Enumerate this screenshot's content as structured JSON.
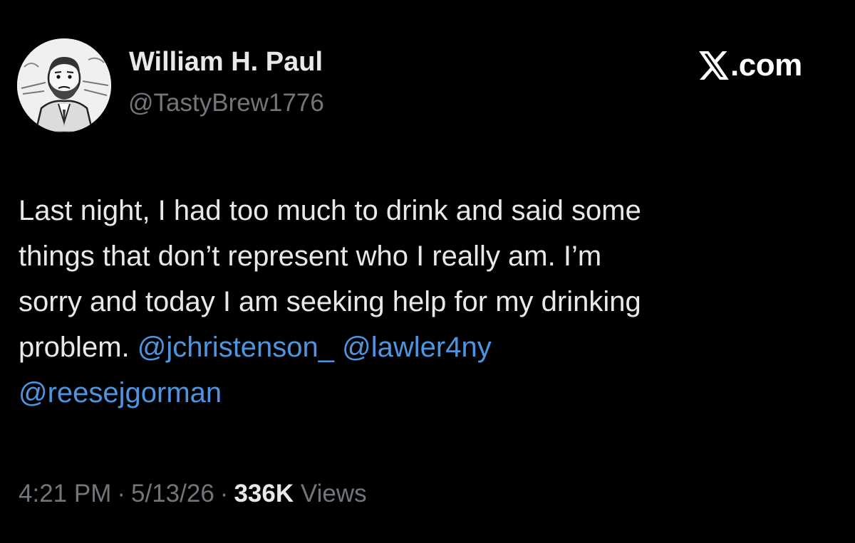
{
  "author": {
    "display_name": "William H. Paul",
    "handle": "@TastyBrew1776",
    "avatar_icon": "caricature-portrait-avatar"
  },
  "brand": {
    "label": ".com",
    "icon": "x-logo-icon"
  },
  "tweet": {
    "lines": [
      "Last night, I had too much to drink and said some",
      "things that don’t represent who I really am. I’m",
      "sorry and today I am seeking help for my drinking"
    ],
    "last_line_prefix": "problem.",
    "mentions": [
      "@jchristenson_",
      "@lawler4ny",
      "@reesejgorman"
    ]
  },
  "meta": {
    "time": "4:21 PM",
    "date": "5/13/26",
    "separator": "·",
    "views_count": "336K",
    "views_label": "Views"
  },
  "colors": {
    "background": "#000000",
    "primary_text": "#e7e9ea",
    "secondary_text": "#71767b",
    "link": "#4f94df"
  }
}
